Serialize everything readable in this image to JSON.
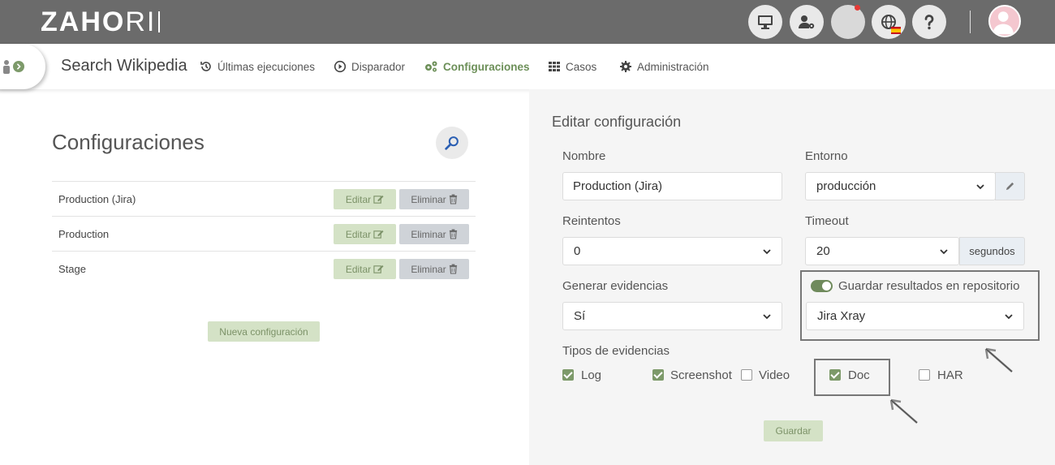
{
  "app": {
    "logo_main": "ZAH",
    "logo_o": "O",
    "logo_thin": "RI"
  },
  "nav": {
    "project_title": "Search Wikipedia",
    "items": [
      {
        "label": "Últimas ejecuciones",
        "icon": "history-icon"
      },
      {
        "label": "Disparador",
        "icon": "play-icon"
      },
      {
        "label": "Configuraciones",
        "icon": "gears-icon",
        "active": true
      },
      {
        "label": "Casos",
        "icon": "grid-icon"
      },
      {
        "label": "Administración",
        "icon": "gear-icon"
      }
    ]
  },
  "list": {
    "title": "Configuraciones",
    "rows": [
      {
        "name": "Production (Jira)"
      },
      {
        "name": "Production"
      },
      {
        "name": "Stage"
      }
    ],
    "edit_label": "Editar",
    "delete_label": "Eliminar",
    "new_label": "Nueva configuración"
  },
  "form": {
    "title": "Editar configuración",
    "name_label": "Nombre",
    "name_value": "Production (Jira)",
    "env_label": "Entorno",
    "env_value": "producción",
    "retries_label": "Reintentos",
    "retries_value": "0",
    "timeout_label": "Timeout",
    "timeout_value": "20",
    "timeout_unit": "segundos",
    "evidence_label": "Generar evidencias",
    "evidence_value": "Sí",
    "repo_toggle_label": "Guardar resultados en repositorio",
    "repo_value": "Jira Xray",
    "evidence_types_label": "Tipos de evidencias",
    "evidence_types": [
      {
        "label": "Log",
        "checked": true
      },
      {
        "label": "Screenshot",
        "checked": true
      },
      {
        "label": "Video",
        "checked": false
      },
      {
        "label": "Doc",
        "checked": true
      },
      {
        "label": "HAR",
        "checked": false
      }
    ],
    "save_label": "Guardar"
  },
  "colors": {
    "accent": "#6c8f58",
    "topbar": "#6b6b6b",
    "panel": "#f5f5f5"
  }
}
